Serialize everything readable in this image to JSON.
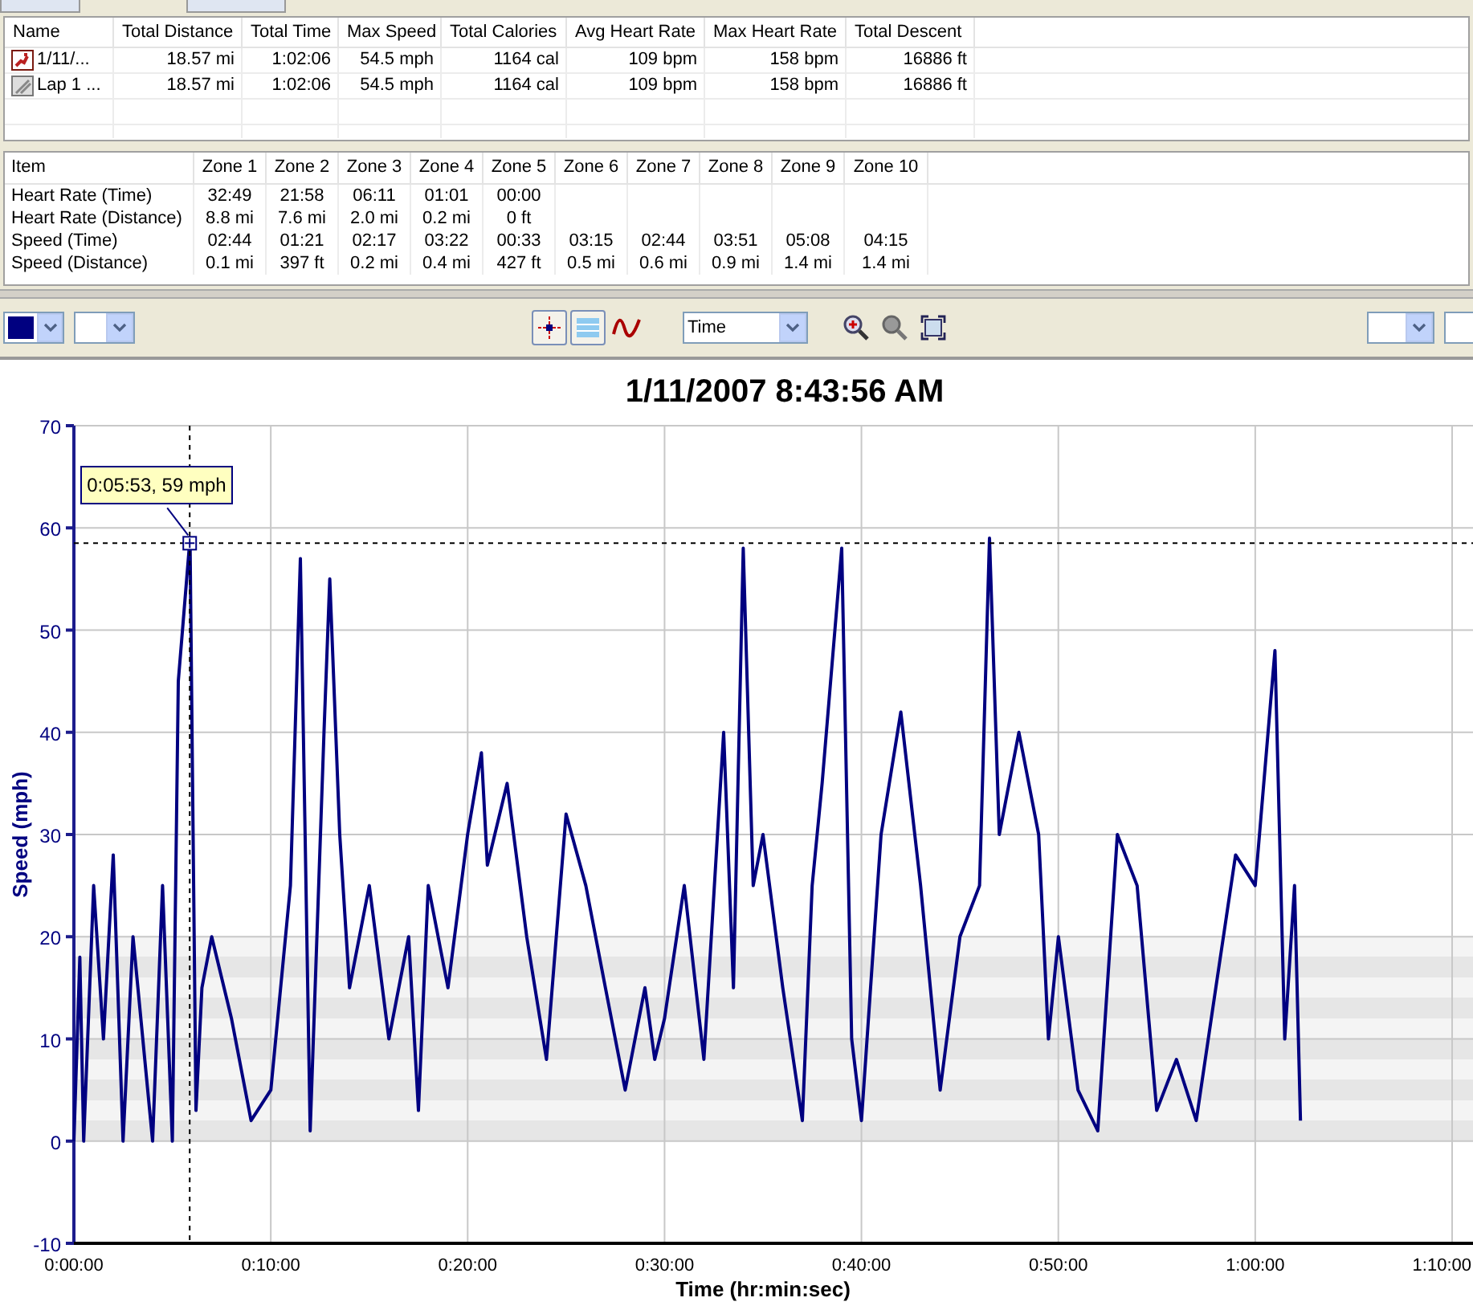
{
  "summary_table": {
    "columns": [
      "Name",
      "Total Distance",
      "Total Time",
      "Max Speed",
      "Total Calories",
      "Avg Heart Rate",
      "Max Heart Rate",
      "Total Descent"
    ],
    "rows": [
      {
        "kind": "activity",
        "cells": [
          "1/11/...",
          "18.57 mi",
          "1:02:06",
          "54.5 mph",
          "1164 cal",
          "109 bpm",
          "158 bpm",
          "16886 ft"
        ]
      },
      {
        "kind": "lap",
        "cells": [
          "Lap 1 ...",
          "18.57 mi",
          "1:02:06",
          "54.5 mph",
          "1164 cal",
          "109 bpm",
          "158 bpm",
          "16886 ft"
        ]
      }
    ]
  },
  "zone_table": {
    "columns": [
      "Item",
      "Zone 1",
      "Zone 2",
      "Zone 3",
      "Zone 4",
      "Zone 5",
      "Zone 6",
      "Zone 7",
      "Zone 8",
      "Zone 9",
      "Zone 10"
    ],
    "rows": [
      [
        "Heart Rate (Time)",
        "32:49",
        "21:58",
        "06:11",
        "01:01",
        "00:00"
      ],
      [
        "Heart Rate (Distance)",
        "8.8 mi",
        "7.6 mi",
        "2.0 mi",
        "0.2 mi",
        "0 ft"
      ],
      [
        "Speed (Time)",
        "02:44",
        "01:21",
        "02:17",
        "03:22",
        "00:33",
        "03:15",
        "02:44",
        "03:51",
        "05:08",
        "04:15"
      ],
      [
        "Speed (Distance)",
        "0.1 mi",
        "397 ft",
        "0.2 mi",
        "0.4 mi",
        "427 ft",
        "0.5 mi",
        "0.6 mi",
        "0.9 mi",
        "1.4 mi",
        "1.4 mi"
      ]
    ]
  },
  "toolbar": {
    "toggles": [
      {
        "kind": "crosshair",
        "on": true
      },
      {
        "kind": "bands",
        "on": true
      },
      {
        "kind": "line",
        "on": false
      }
    ],
    "x_axis_dropdown": "Time"
  },
  "chart": {
    "chart_data": {
      "type": "line",
      "title": "1/11/2007 8:43:56 AM",
      "ylabel": "Speed (mph)",
      "xlabel": "Time (hr:min:sec)",
      "x": [
        0,
        0.3,
        0.5,
        1,
        1.5,
        2,
        2.5,
        3,
        4,
        4.5,
        5,
        5.3,
        5.9,
        6.2,
        6.5,
        7,
        8,
        9,
        10,
        11,
        11.5,
        12,
        12.7,
        13,
        13.5,
        14,
        15,
        16,
        17,
        17.5,
        18,
        19,
        20,
        20.7,
        21,
        22,
        23,
        24,
        25,
        26,
        27,
        28,
        29,
        29.5,
        30,
        31,
        32,
        33,
        33.5,
        34,
        34.5,
        35,
        36,
        37,
        37.5,
        38,
        39,
        39.5,
        40,
        41,
        42,
        43,
        44,
        45,
        46,
        46.5,
        47,
        48,
        49,
        49.5,
        50,
        51,
        52,
        53,
        54,
        55,
        56,
        57,
        58,
        59,
        60,
        61,
        61.5,
        62,
        62.3
      ],
      "series": [
        {
          "color": "#000080",
          "values": [
            0,
            18,
            0,
            25,
            10,
            28,
            0,
            20,
            0,
            25,
            0,
            45,
            59,
            3,
            15,
            20,
            12,
            2,
            5,
            25,
            57,
            1,
            40,
            55,
            30,
            15,
            25,
            10,
            20,
            3,
            25,
            15,
            30,
            38,
            27,
            35,
            20,
            8,
            32,
            25,
            15,
            5,
            15,
            8,
            12,
            25,
            8,
            40,
            15,
            58,
            25,
            30,
            15,
            2,
            25,
            35,
            58,
            10,
            2,
            30,
            42,
            25,
            5,
            20,
            25,
            59,
            30,
            40,
            30,
            10,
            20,
            5,
            1,
            30,
            25,
            3,
            8,
            2,
            15,
            28,
            25,
            48,
            10,
            25,
            2
          ]
        }
      ],
      "xlim": [
        0,
        70
      ],
      "ylim": [
        -10,
        70
      ],
      "xticks": [
        {
          "value": 0,
          "label": "0:00:00"
        },
        {
          "value": 10,
          "label": "0:10:00"
        },
        {
          "value": 20,
          "label": "0:20:00"
        },
        {
          "value": 30,
          "label": "0:30:00"
        },
        {
          "value": 40,
          "label": "0:40:00"
        },
        {
          "value": 50,
          "label": "0:50:00"
        },
        {
          "value": 60,
          "label": "1:00:00"
        },
        {
          "value": 70,
          "label": "1:10:00"
        }
      ],
      "yticks": [
        70,
        60,
        50,
        40,
        30,
        20,
        10,
        0,
        -10
      ],
      "grid": true,
      "ref_lines": [
        {
          "axis": "x",
          "value": 5.883
        },
        {
          "axis": "y",
          "value": 58.5
        }
      ],
      "annotations": [
        {
          "x": 5.883,
          "y": 58.5,
          "text": "0:05:53, 59 mph"
        }
      ]
    }
  }
}
